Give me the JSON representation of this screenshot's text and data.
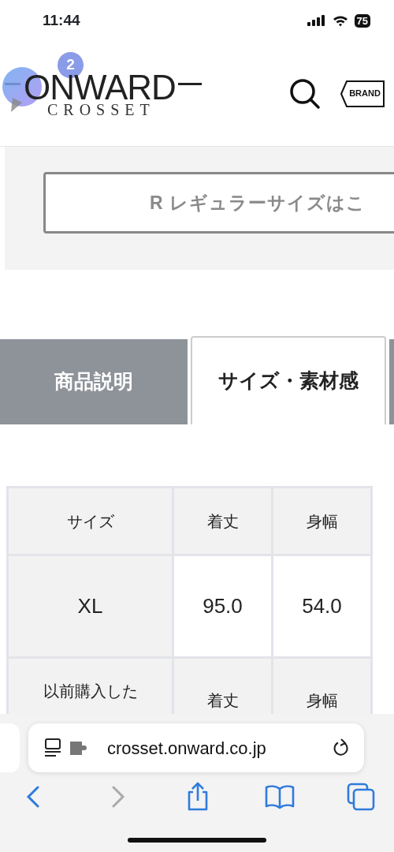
{
  "status_bar": {
    "time": "11:44",
    "battery": "75"
  },
  "header": {
    "logo": {
      "wordmark": "ONWARD",
      "sub": "CROSSET"
    },
    "brand_button": "BRAND"
  },
  "chat_widget": {
    "badge": "2"
  },
  "size_link": {
    "label": "R レギュラーサイズはこ"
  },
  "tabs": [
    {
      "label": "商品説明",
      "selected": false
    },
    {
      "label": "サイズ・素材感",
      "selected": true
    }
  ],
  "size_table": {
    "columns": [
      "サイズ",
      "着丈",
      "身幅"
    ],
    "rows": [
      {
        "cells": [
          "XL",
          "95.0",
          "54.0"
        ]
      },
      {
        "cells": [
          "以前購入した",
          "着丈",
          "身幅"
        ]
      }
    ]
  },
  "browser": {
    "url": "crosset.onward.co.jp",
    "toolbar": [
      {
        "kind": "back",
        "disabled": false
      },
      {
        "kind": "forward",
        "disabled": true
      },
      {
        "kind": "share",
        "disabled": false
      },
      {
        "kind": "bookmarks",
        "disabled": false
      },
      {
        "kind": "tabs",
        "disabled": false
      }
    ]
  }
}
